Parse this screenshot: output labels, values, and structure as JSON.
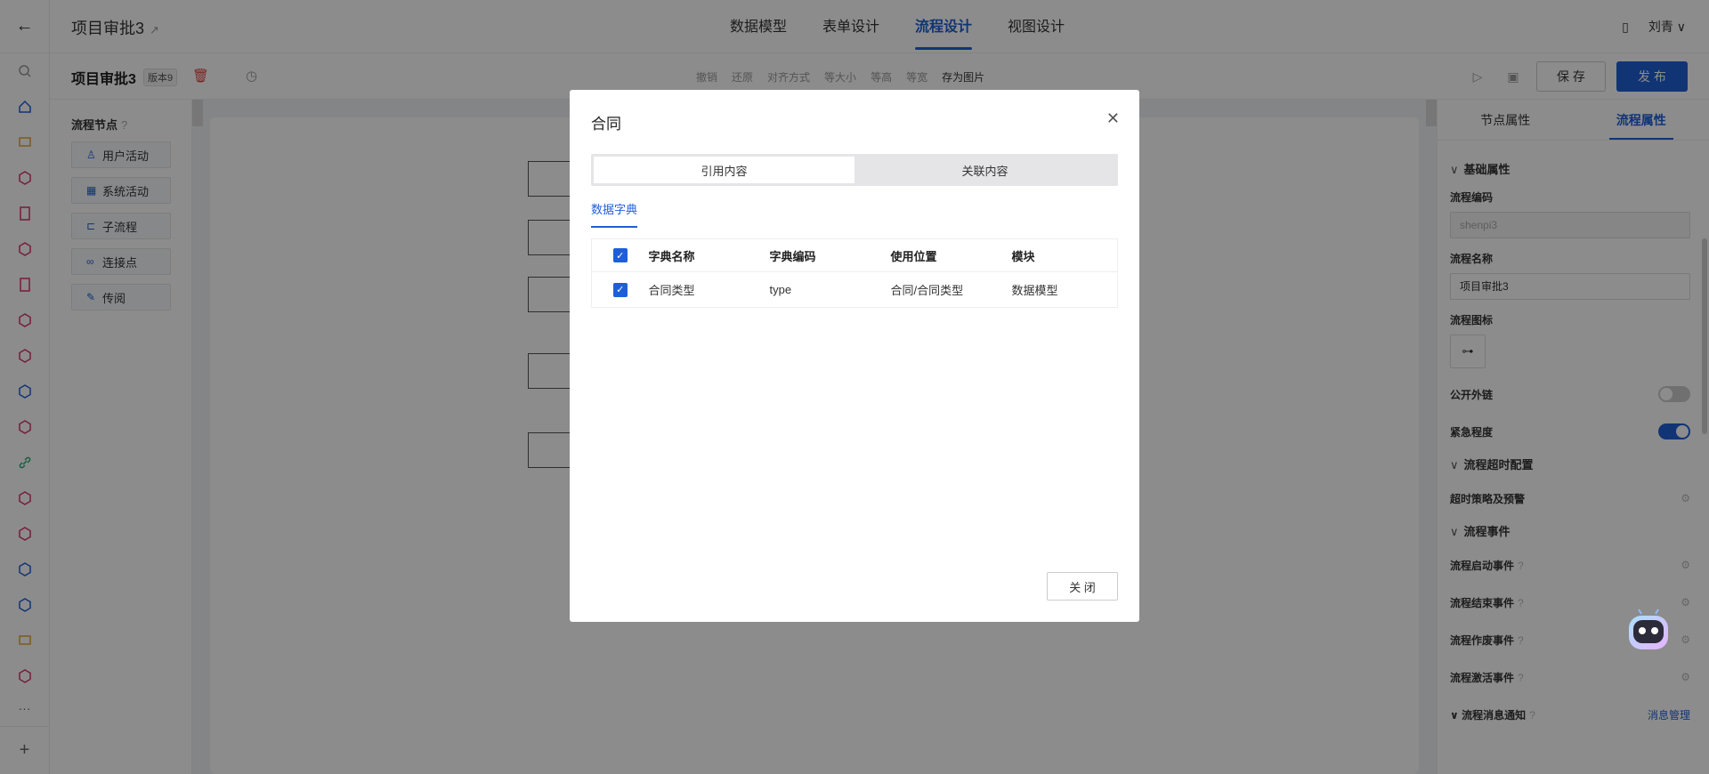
{
  "app": {
    "title": "项目审批3",
    "tabs": [
      "数据模型",
      "表单设计",
      "流程设计",
      "视图设计"
    ],
    "active_tab": "流程设计",
    "user": "刘青"
  },
  "toolbar": {
    "process_name": "项目审批3",
    "version": "版本9",
    "tools": [
      "撤销",
      "还原",
      "对齐方式",
      "等大小",
      "等高",
      "等宽",
      "存为图片"
    ],
    "save_label": "保 存",
    "publish_label": "发 布"
  },
  "nodes": {
    "heading": "流程节点",
    "items": [
      {
        "label": "用户活动",
        "icon": "user-icon"
      },
      {
        "label": "系统活动",
        "icon": "grid-icon"
      },
      {
        "label": "子流程",
        "icon": "subflow-icon"
      },
      {
        "label": "连接点",
        "icon": "link-icon"
      },
      {
        "label": "传阅",
        "icon": "edit-icon"
      }
    ]
  },
  "right_panel": {
    "tabs": [
      "节点属性",
      "流程属性"
    ],
    "active_tab": "流程属性",
    "section_basic": "基础属性",
    "code_label": "流程编码",
    "code_value": "shenpi3",
    "name_label": "流程名称",
    "name_value": "项目审批3",
    "icon_label": "流程图标",
    "public_link_label": "公开外链",
    "public_link_on": false,
    "urgency_label": "紧急程度",
    "urgency_on": true,
    "section_timeout": "流程超时配置",
    "timeout_policy_label": "超时策略及预警",
    "section_events": "流程事件",
    "events": [
      "流程启动事件",
      "流程结束事件",
      "流程作废事件",
      "流程激活事件"
    ],
    "section_notify": "流程消息通知",
    "notify_link": "消息管理"
  },
  "modal": {
    "title": "合同",
    "segments": [
      "引用内容",
      "关联内容"
    ],
    "active_segment": "引用内容",
    "subtab": "数据字典",
    "columns": [
      "字典名称",
      "字典编码",
      "使用位置",
      "模块"
    ],
    "rows": [
      {
        "name": "合同类型",
        "code": "type",
        "location": "合同/合同类型",
        "module": "数据模型",
        "checked": true
      }
    ],
    "close_label": "关 闭"
  },
  "colors": {
    "accent": "#1f5fd6",
    "danger": "#e0443e"
  }
}
